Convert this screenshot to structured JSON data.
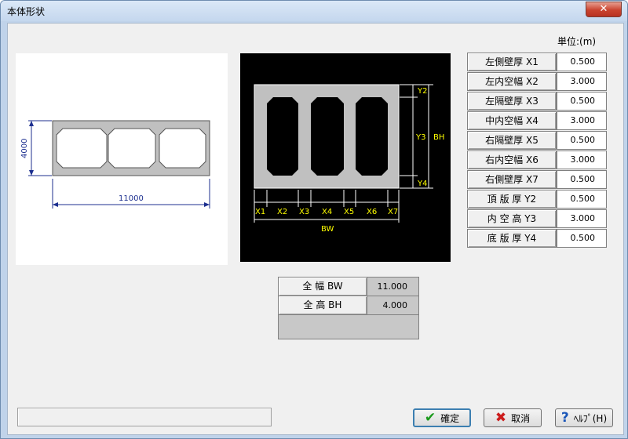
{
  "window": {
    "title": "本体形状",
    "close_glyph": "✕"
  },
  "unit_label": "単位:(m)",
  "preview": {
    "dim_height": "4000",
    "dim_width": "11000"
  },
  "schematic": {
    "labels": {
      "y2": "Y2",
      "y3": "Y3",
      "y4": "Y4",
      "bh": "BH",
      "x1": "X1",
      "x2": "X2",
      "x3": "X3",
      "x4": "X4",
      "x5": "X5",
      "x6": "X6",
      "x7": "X7",
      "bw": "BW"
    }
  },
  "params": [
    {
      "label": "左側壁厚 X1",
      "value": "0.500"
    },
    {
      "label": "左内空幅 X2",
      "value": "3.000"
    },
    {
      "label": "左隔壁厚 X3",
      "value": "0.500"
    },
    {
      "label": "中内空幅 X4",
      "value": "3.000"
    },
    {
      "label": "右隔壁厚 X5",
      "value": "0.500"
    },
    {
      "label": "右内空幅 X6",
      "value": "3.000"
    },
    {
      "label": "右側壁厚 X7",
      "value": "0.500"
    },
    {
      "label": "頂 版 厚 Y2",
      "value": "0.500"
    },
    {
      "label": "内 空 高 Y3",
      "value": "3.000"
    },
    {
      "label": "底 版 厚 Y4",
      "value": "0.500"
    }
  ],
  "totals": [
    {
      "label": "全 幅 BW",
      "value": "11.000"
    },
    {
      "label": "全 高 BH",
      "value": "4.000"
    }
  ],
  "buttons": {
    "ok": "確定",
    "cancel": "取消",
    "help": "ﾍﾙﾌﾟ(H)"
  },
  "colors": {
    "accent_yellow": "#ffff00",
    "dim_blue": "#1c2f8f",
    "section_gray": "#c0c0c0"
  }
}
